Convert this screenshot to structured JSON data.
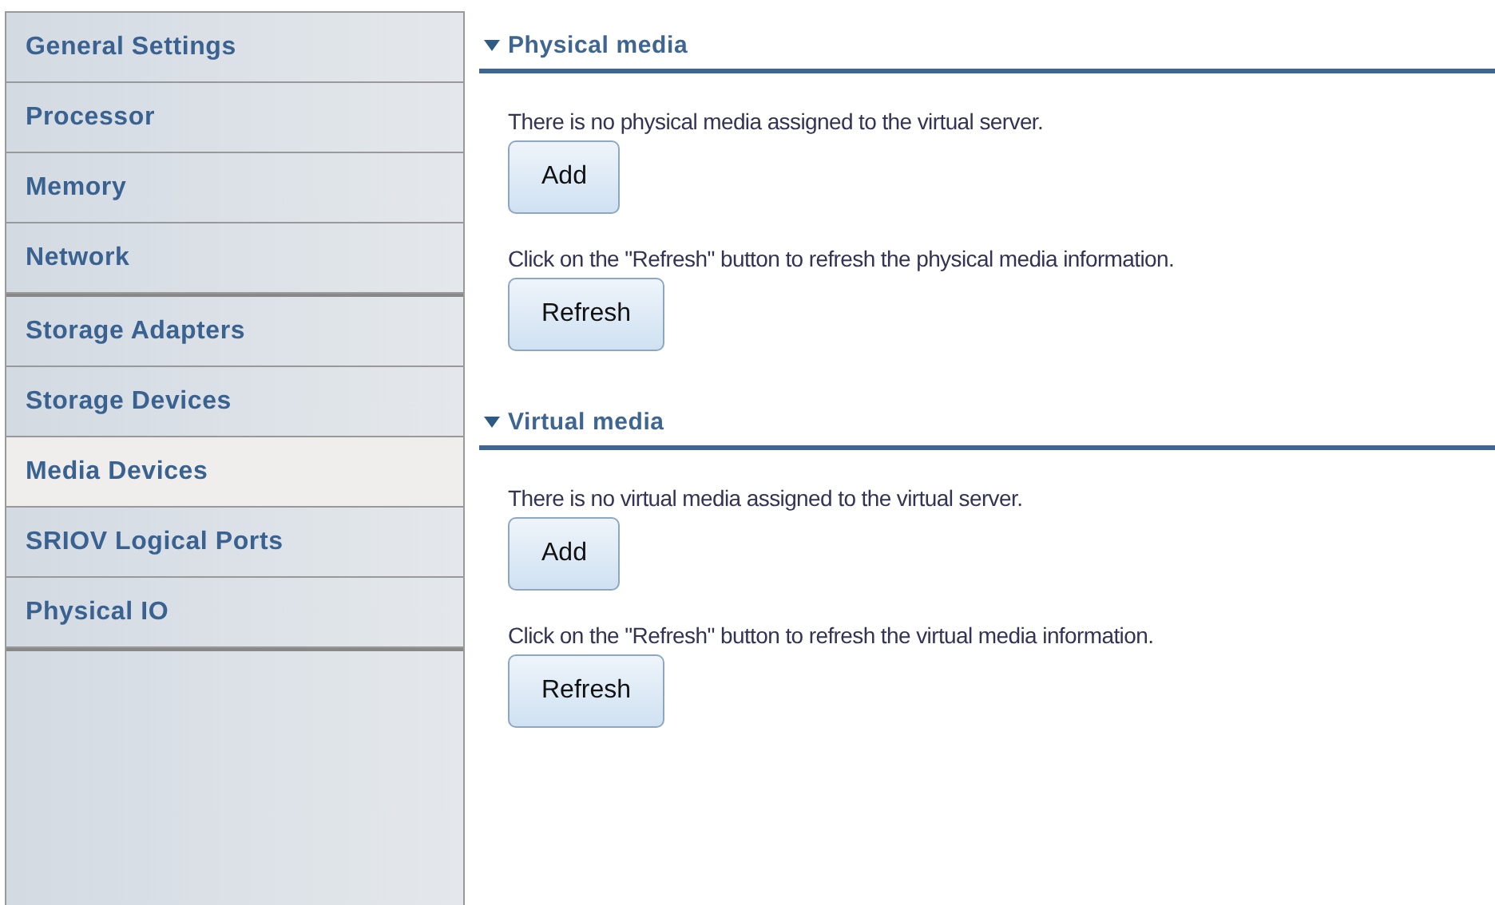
{
  "sidebar": {
    "groups": [
      {
        "items": [
          {
            "label": "General Settings",
            "selected": false
          },
          {
            "label": "Processor",
            "selected": false
          },
          {
            "label": "Memory",
            "selected": false
          },
          {
            "label": "Network",
            "selected": false
          }
        ]
      },
      {
        "items": [
          {
            "label": "Storage Adapters",
            "selected": false
          },
          {
            "label": "Storage Devices",
            "selected": false
          },
          {
            "label": "Media Devices",
            "selected": true
          },
          {
            "label": "SRIOV Logical Ports",
            "selected": false
          },
          {
            "label": "Physical IO",
            "selected": false
          }
        ]
      }
    ]
  },
  "sections": [
    {
      "title": "Physical media",
      "expanded": true,
      "message": "There is no physical media assigned to the virtual server.",
      "add_button": "Add",
      "refresh_hint": "Click on the \"Refresh\" button to refresh the physical media information.",
      "refresh_button": "Refresh"
    },
    {
      "title": "Virtual media",
      "expanded": true,
      "message": "There is no virtual media assigned to the virtual server.",
      "add_button": "Add",
      "refresh_hint": "Click on the \"Refresh\" button to refresh the virtual media information.",
      "refresh_button": "Refresh"
    }
  ]
}
